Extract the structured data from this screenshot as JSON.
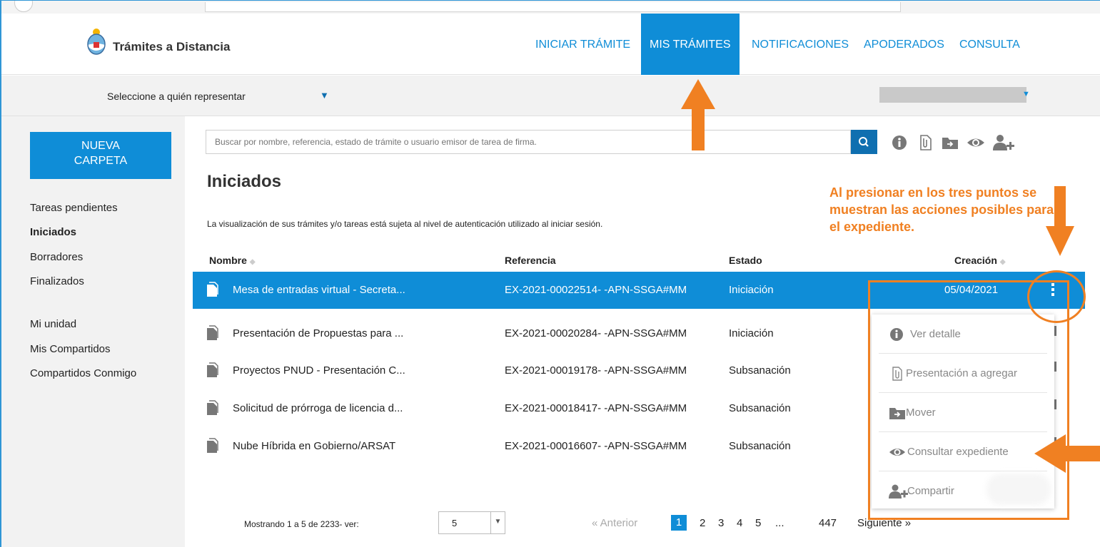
{
  "header": {
    "brand": "Trámites a Distancia",
    "nav": [
      "INICIAR TRÁMITE",
      "MIS TRÁMITES",
      "NOTIFICACIONES",
      "APODERADOS",
      "CONSULTA"
    ],
    "active_nav": "MIS TRÁMITES"
  },
  "representation": {
    "label": "Seleccione a quién representar"
  },
  "sidebar": {
    "new_folder": "NUEVA\nCARPETA",
    "links": [
      "Tareas pendientes",
      "Iniciados",
      "Borradores",
      "Finalizados",
      "Mi unidad",
      "Mis Compartidos",
      "Compartidos Conmigo"
    ],
    "active": "Iniciados"
  },
  "search": {
    "placeholder": "Buscar por nombre, referencia, estado de trámite o usuario emisor de tarea de firma."
  },
  "toolbar_icons": [
    "info-icon",
    "attachment-icon",
    "move-folder-icon",
    "eye-icon",
    "add-user-icon"
  ],
  "main": {
    "title": "Iniciados",
    "notice": "La visualización de sus trámites y/o tareas está sujeta al nivel de autenticación utilizado al iniciar sesión."
  },
  "table": {
    "headers": {
      "name": "Nombre",
      "reference": "Referencia",
      "status": "Estado",
      "created": "Creación"
    },
    "rows": [
      {
        "name": "Mesa de entradas virtual - Secreta...",
        "reference": "EX-2021-00022514- -APN-SSGA#MM",
        "status": "Iniciación",
        "created": "05/04/2021",
        "selected": true
      },
      {
        "name": "Presentación de Propuestas para ...",
        "reference": "EX-2021-00020284- -APN-SSGA#MM",
        "status": "Iniciación",
        "created": ""
      },
      {
        "name": "Proyectos PNUD - Presentación C...",
        "reference": "EX-2021-00019178- -APN-SSGA#MM",
        "status": "Subsanación",
        "created": ""
      },
      {
        "name": "Solicitud de prórroga de licencia d...",
        "reference": "EX-2021-00018417- -APN-SSGA#MM",
        "status": "Subsanación",
        "created": ""
      },
      {
        "name": "Nube Híbrida en Gobierno/ARSAT",
        "reference": "EX-2021-00016607- -APN-SSGA#MM",
        "status": "Subsanación",
        "created": ""
      }
    ]
  },
  "actions_menu": [
    {
      "label": "Ver detalle",
      "icon": "info-icon"
    },
    {
      "label": "Presentación a agregar",
      "icon": "attachment-icon"
    },
    {
      "label": "Mover",
      "icon": "move-folder-icon"
    },
    {
      "label": "Consultar expediente",
      "icon": "eye-icon"
    },
    {
      "label": "Compartir",
      "icon": "add-user-icon"
    }
  ],
  "pagination": {
    "summary": "Mostrando 1 a 5 de 2233- ver:",
    "page_size": "5",
    "prev": "« Anterior",
    "pages": [
      "1",
      "2",
      "3",
      "4",
      "5",
      "...",
      "447"
    ],
    "current": "1",
    "next": "Siguiente »"
  },
  "annotation": {
    "text": "Al presionar en los tres puntos se muestran las acciones posibles para el expediente.",
    "color": "#f08022"
  },
  "colors": {
    "primary": "#0f8dd7",
    "dark_primary": "#0f6fb0",
    "annotation": "#f08022"
  }
}
